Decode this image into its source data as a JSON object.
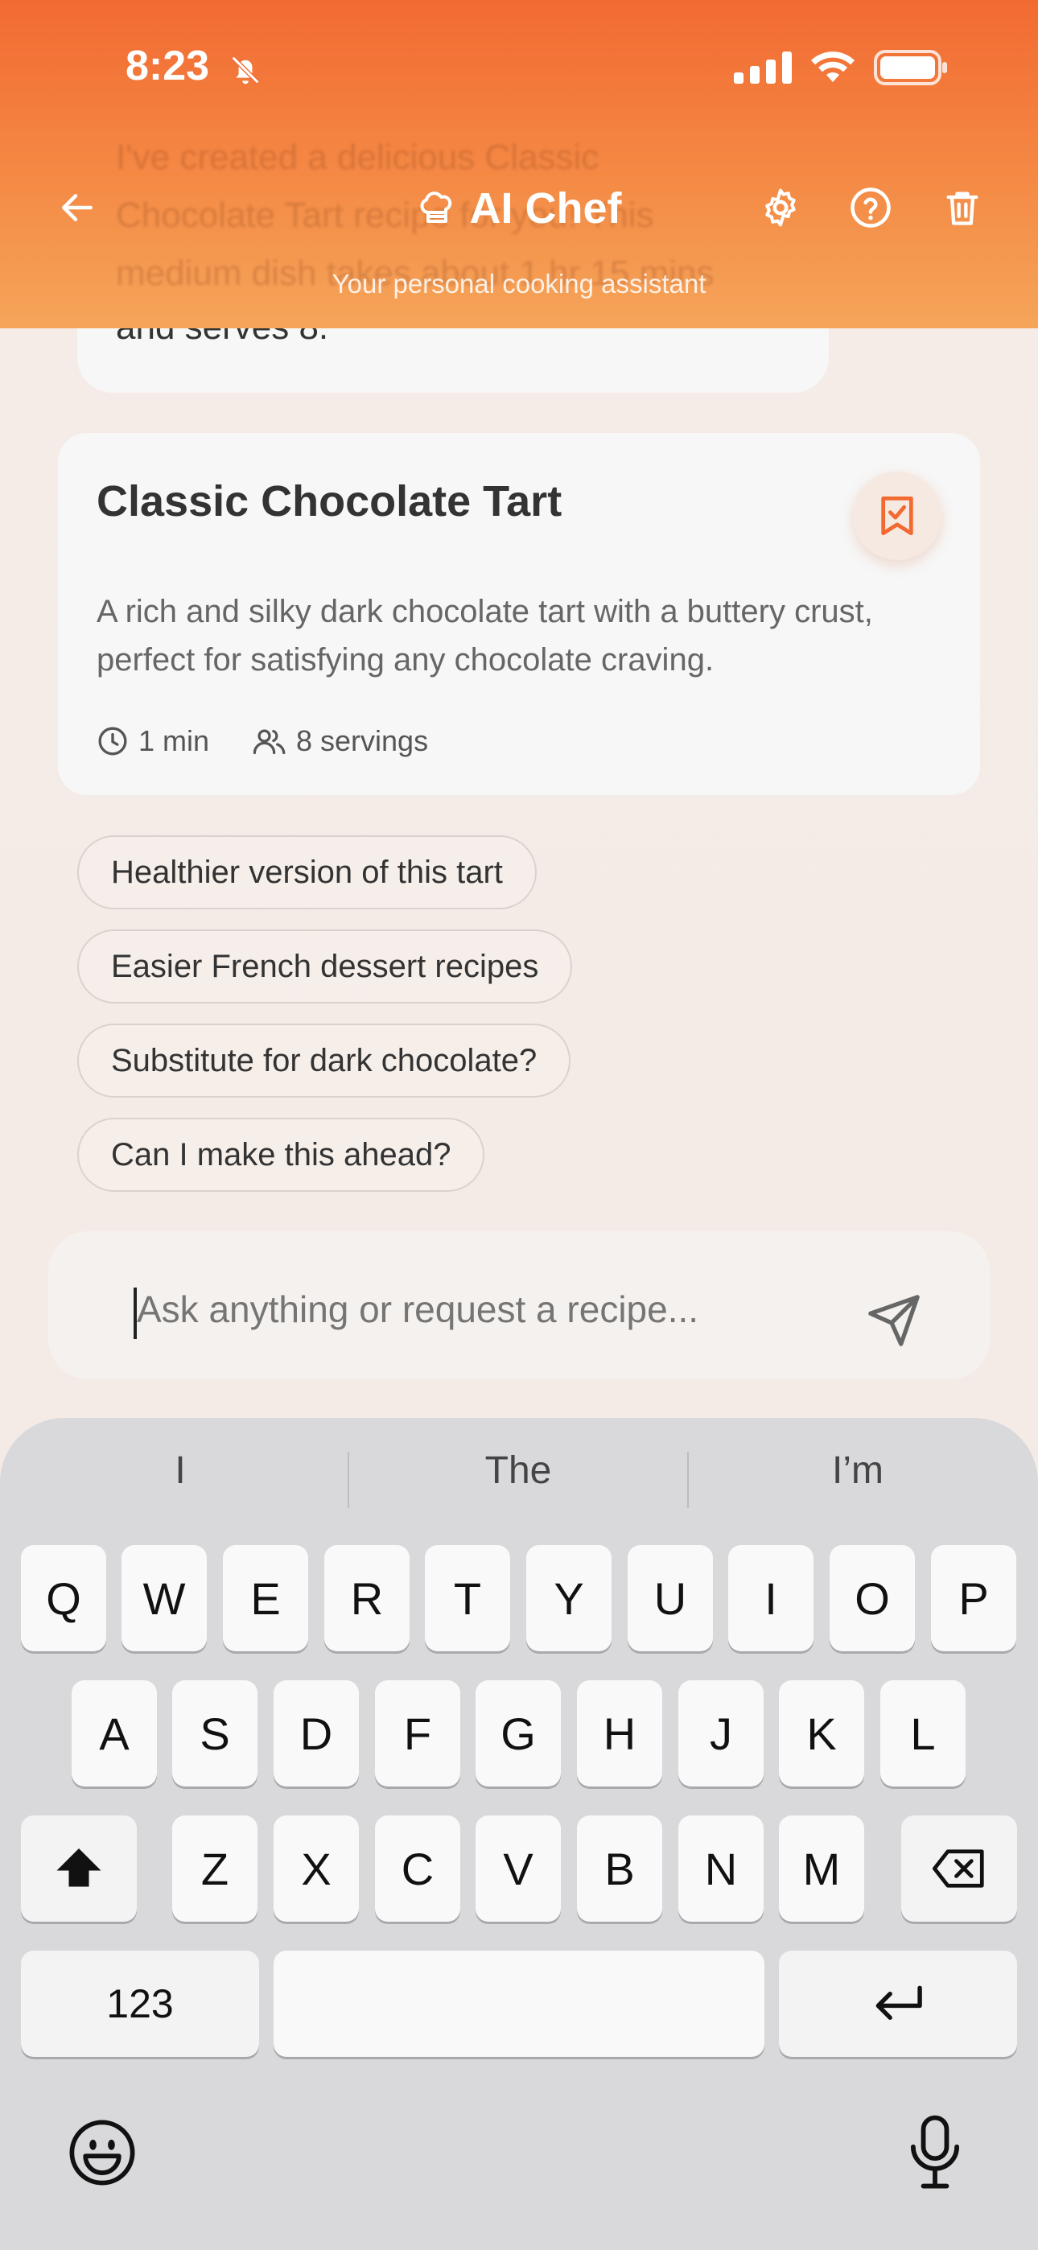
{
  "status": {
    "time": "8:23"
  },
  "header": {
    "title": "AI Chef",
    "subtitle": "Your personal cooking assistant",
    "ghost_lines": [
      "I've created a delicious Classic",
      "Chocolate Tart recipe for you! This",
      "medium dish takes about 1 hr 15 mins"
    ]
  },
  "previous_message": {
    "last_line": "and serves 8."
  },
  "recipe": {
    "title": "Classic Chocolate Tart",
    "description": "A rich and silky dark chocolate tart with a buttery crust, perfect for satisfying any chocolate craving.",
    "time": "1 min",
    "servings": "8 servings"
  },
  "suggestions": [
    "Healthier version of this tart",
    "Easier French dessert recipes",
    "Substitute for dark chocolate?",
    "Can I make this ahead?"
  ],
  "input": {
    "placeholder": "Ask anything or request a recipe..."
  },
  "keyboard": {
    "predictions": [
      "I",
      "The",
      "I’m"
    ],
    "row1": [
      "Q",
      "W",
      "E",
      "R",
      "T",
      "Y",
      "U",
      "I",
      "O",
      "P"
    ],
    "row2": [
      "A",
      "S",
      "D",
      "F",
      "G",
      "H",
      "J",
      "K",
      "L"
    ],
    "row3": [
      "Z",
      "X",
      "C",
      "V",
      "B",
      "N",
      "M"
    ],
    "numbers_key": "123"
  },
  "colors": {
    "accent": "#f26a32",
    "accent_light": "#f5a55a"
  }
}
